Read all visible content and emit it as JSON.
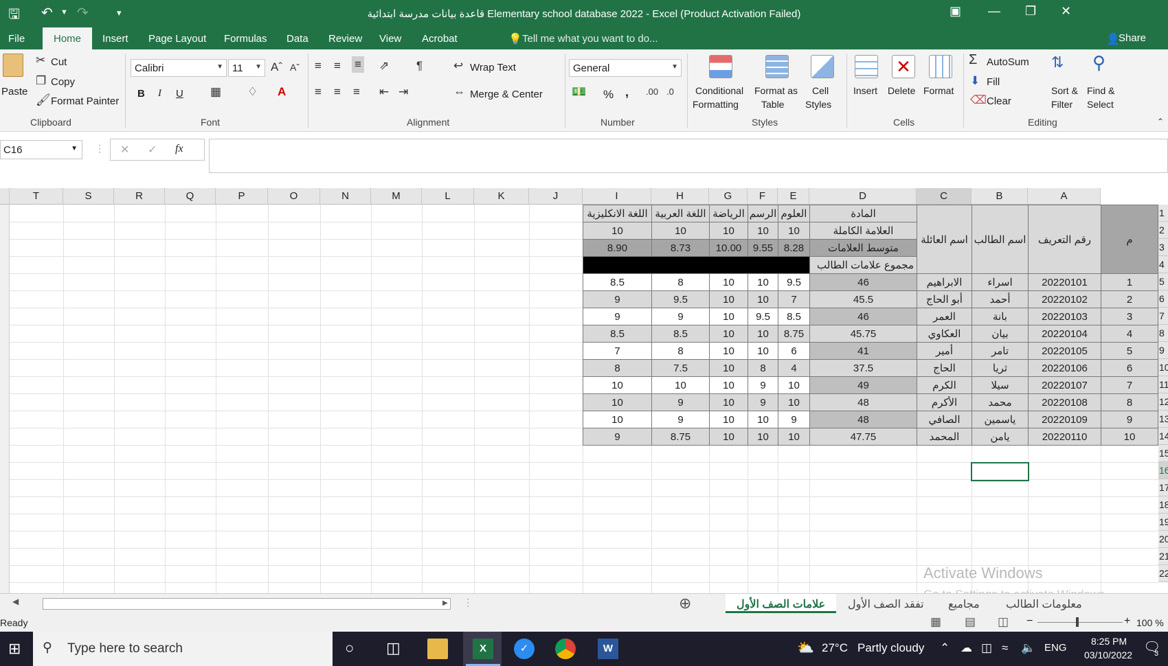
{
  "window": {
    "title": "قاعدة بيانات مدرسة ابتدائية Elementary school database 2022 - Excel (Product Activation Failed)"
  },
  "menu": {
    "tabs": [
      "File",
      "Home",
      "Insert",
      "Page Layout",
      "Formulas",
      "Data",
      "Review",
      "View",
      "Acrobat"
    ],
    "active": "Home",
    "tell_me": "Tell me what you want to do...",
    "share": "Share"
  },
  "ribbon": {
    "clipboard": {
      "paste": "Paste",
      "cut": "Cut",
      "copy": "Copy",
      "format_painter": "Format Painter",
      "label": "Clipboard"
    },
    "font": {
      "name": "Calibri",
      "size": "11",
      "bold": "B",
      "italic": "I",
      "underline": "U",
      "label": "Font"
    },
    "alignment": {
      "wrap_text": "Wrap Text",
      "merge_center": "Merge & Center",
      "label": "Alignment"
    },
    "number": {
      "format": "General",
      "percent": "%",
      "comma": ",",
      "label": "Number"
    },
    "styles": {
      "conditional_1": "Conditional",
      "conditional_2": "Formatting",
      "format_table_1": "Format as",
      "format_table_2": "Table",
      "cell_styles_1": "Cell",
      "cell_styles_2": "Styles",
      "label": "Styles"
    },
    "cells": {
      "insert": "Insert",
      "delete": "Delete",
      "format": "Format",
      "label": "Cells"
    },
    "editing": {
      "autosum": "AutoSum",
      "fill": "Fill",
      "clear": "Clear",
      "sort_1": "Sort &",
      "sort_2": "Filter",
      "find_1": "Find &",
      "find_2": "Select",
      "label": "Editing"
    }
  },
  "formula_bar": {
    "name_box": "C16",
    "fx": "fx",
    "value": ""
  },
  "columns": [
    "T",
    "S",
    "R",
    "Q",
    "P",
    "O",
    "N",
    "M",
    "L",
    "K",
    "J",
    "I",
    "H",
    "G",
    "F",
    "E",
    "D",
    "C",
    "B",
    "A"
  ],
  "rows": [
    "1",
    "2",
    "3",
    "4",
    "5",
    "6",
    "7",
    "8",
    "9",
    "10",
    "11",
    "12",
    "13",
    "14",
    "15",
    "16",
    "17",
    "18",
    "19",
    "20",
    "21",
    "22"
  ],
  "table": {
    "subject_label": "المادة",
    "full_mark_label": "العلامة الكاملة",
    "average_label": "متوسط العلامات",
    "total_label": "مجموع علامات الطالب",
    "col_m": "م",
    "col_id": "رقم التعريف",
    "col_name": "اسم الطالب",
    "col_family": "اسم العائلة",
    "subjects": [
      "العلوم",
      "الرسم",
      "الرياضة",
      "اللغة العربية",
      "اللغة الانكليزية"
    ],
    "full_marks": [
      "10",
      "10",
      "10",
      "10",
      "10"
    ],
    "averages": [
      "8.28",
      "9.55",
      "10.00",
      "8.73",
      "8.90"
    ],
    "students": [
      {
        "m": "1",
        "id": "20220101",
        "name": "اسراء",
        "family": "الابراهيم",
        "total": "46",
        "science": "9.5",
        "drawing": "10",
        "sport": "10",
        "arabic": "8",
        "english": "8.5"
      },
      {
        "m": "2",
        "id": "20220102",
        "name": "أحمد",
        "family": "أبو الحاج",
        "total": "45.5",
        "science": "7",
        "drawing": "10",
        "sport": "10",
        "arabic": "9.5",
        "english": "9"
      },
      {
        "m": "3",
        "id": "20220103",
        "name": "بانة",
        "family": "العمر",
        "total": "46",
        "science": "8.5",
        "drawing": "9.5",
        "sport": "10",
        "arabic": "9",
        "english": "9"
      },
      {
        "m": "4",
        "id": "20220104",
        "name": "بيان",
        "family": "العكاوي",
        "total": "45.75",
        "science": "8.75",
        "drawing": "10",
        "sport": "10",
        "arabic": "8.5",
        "english": "8.5"
      },
      {
        "m": "5",
        "id": "20220105",
        "name": "تامر",
        "family": "أمير",
        "total": "41",
        "science": "6",
        "drawing": "10",
        "sport": "10",
        "arabic": "8",
        "english": "7"
      },
      {
        "m": "6",
        "id": "20220106",
        "name": "ثريا",
        "family": "الحاج",
        "total": "37.5",
        "science": "4",
        "drawing": "8",
        "sport": "10",
        "arabic": "7.5",
        "english": "8"
      },
      {
        "m": "7",
        "id": "20220107",
        "name": "سيلا",
        "family": "الكرم",
        "total": "49",
        "science": "10",
        "drawing": "9",
        "sport": "10",
        "arabic": "10",
        "english": "10"
      },
      {
        "m": "8",
        "id": "20220108",
        "name": "محمد",
        "family": "الأكرم",
        "total": "48",
        "science": "10",
        "drawing": "9",
        "sport": "10",
        "arabic": "9",
        "english": "10"
      },
      {
        "m": "9",
        "id": "20220109",
        "name": "ياسمين",
        "family": "الصافي",
        "total": "48",
        "science": "9",
        "drawing": "10",
        "sport": "10",
        "arabic": "9",
        "english": "10"
      },
      {
        "m": "10",
        "id": "20220110",
        "name": "يامن",
        "family": "المحمد",
        "total": "47.75",
        "science": "10",
        "drawing": "10",
        "sport": "10",
        "arabic": "8.75",
        "english": "9"
      }
    ]
  },
  "watermark": {
    "line1": "Activate Windows",
    "line2": "Go to Settings to activate Windows."
  },
  "sheets": {
    "tabs": [
      "علامات الصف الأول",
      "تفقد الصف الأول",
      "مجاميع",
      "معلومات الطالب"
    ],
    "active": "علامات الصف الأول"
  },
  "status": {
    "ready": "Ready",
    "zoom": "100 %"
  },
  "taskbar": {
    "search": "Type here to search",
    "weather_temp": "27°C",
    "weather_desc": "Partly cloudy",
    "lang": "ENG",
    "time": "8:25 PM",
    "date": "03/10/2022",
    "notifications": "3"
  },
  "colors": {
    "excel_green": "#217346",
    "header_gray": "#e6e6e6",
    "cell_light": "#d9d9d9",
    "cell_dark": "#a6a6a6"
  }
}
